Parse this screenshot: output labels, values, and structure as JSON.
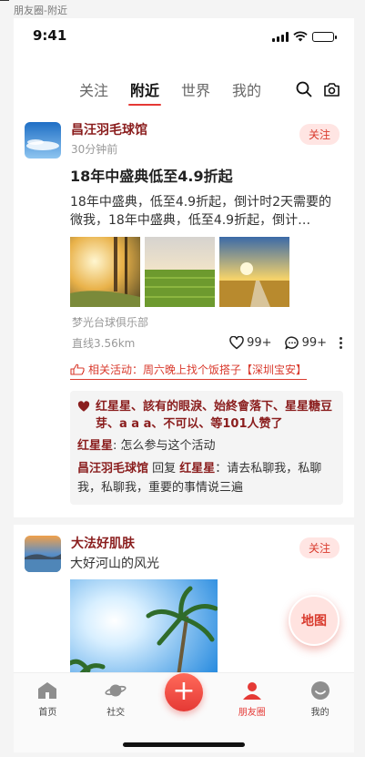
{
  "page_label": "朋友圈-附近",
  "status": {
    "time": "9:41"
  },
  "tabs": [
    {
      "label": "关注"
    },
    {
      "label": "附近"
    },
    {
      "label": "世界"
    },
    {
      "label": "我的"
    }
  ],
  "posts": [
    {
      "author": "昌汪羽毛球馆",
      "time": "30分钟前",
      "follow_label": "关注",
      "title": "18年中盛典低至4.9折起",
      "text": "18年中盛典，低至4.9折起，倒计时2天需要的微我，18年中盛典，低至4.9折起，倒计…",
      "club": "梦光台球俱乐部",
      "distance": "直线3.56km",
      "likes": "99+",
      "comments_count": "99+",
      "activity": "相关活动：周六晚上找个饭搭子【深圳宝安】",
      "liked_by": "红星星、該有的眼淚、始終會落下、星星糖豆芽、a a a、不可以、等101人赞了",
      "comments": [
        {
          "name": "红星星",
          "text": ": 怎么参与这个活动"
        },
        {
          "name": "昌汪羽毛球馆",
          "reply_word": " 回复 ",
          "to": "红星星",
          "text": "：请去私聊我，私聊我，私聊我，重要的事情说三遍"
        }
      ]
    },
    {
      "author": "大法好肌肤",
      "follow_label": "关注",
      "text": "大好河山的风光"
    }
  ],
  "map_button": "地图",
  "tabbar": [
    {
      "label": "首页",
      "icon": "home-icon"
    },
    {
      "label": "社交",
      "icon": "planet-icon"
    },
    {
      "label": "+",
      "icon": "plus-icon"
    },
    {
      "label": "朋友圈",
      "icon": "person-icon"
    },
    {
      "label": "我的",
      "icon": "smiley-icon"
    }
  ],
  "colors": {
    "accent": "#e53935",
    "name": "#8a1d1d",
    "follow_bg": "#ffe5e3"
  }
}
